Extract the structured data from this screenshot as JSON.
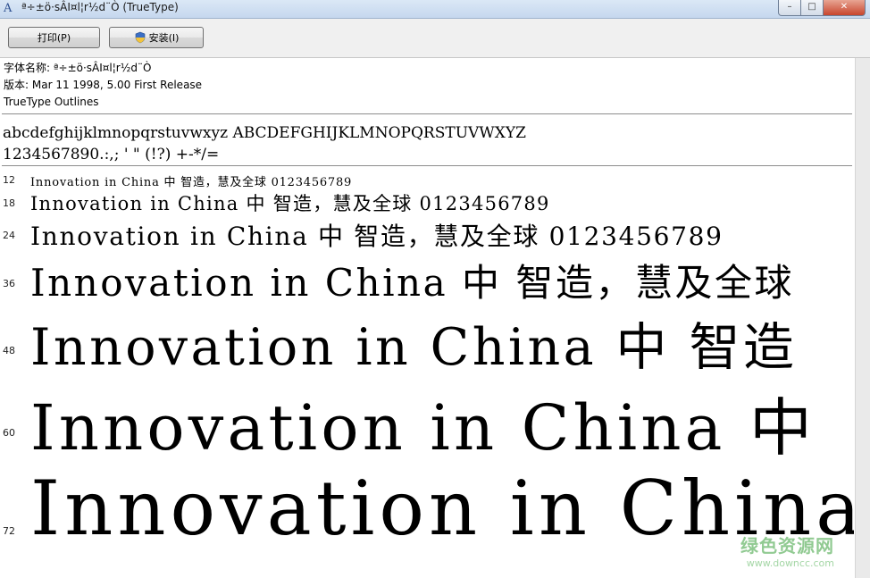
{
  "window": {
    "title": "ª÷±ö·sÂI¤l¦r½d¨Ò (TrueType)",
    "app_icon_glyph": "A",
    "minimize_glyph": "–",
    "maximize_glyph": "□",
    "close_glyph": "✕"
  },
  "toolbar": {
    "print_label": "打印(P)",
    "install_label": "安装(I)"
  },
  "font_info": {
    "name_line": "字体名称: ª÷±ö·sÂI¤l¦r½d¨Ò",
    "version_line": "版本: Mar 11 1998, 5.00 First Release",
    "type_line": "TrueType Outlines"
  },
  "charset": {
    "line1": "abcdefghijklmnopqrstuvwxyz ABCDEFGHIJKLMNOPQRSTUVWXYZ",
    "line2": "1234567890.:,; ' \" (!?) +-*/="
  },
  "samples": [
    {
      "size": "12",
      "text": "Innovation in China 中  智造，慧及全球 0123456789"
    },
    {
      "size": "18",
      "text": "Innovation in China 中  智造，慧及全球 0123456789"
    },
    {
      "size": "24",
      "text": "Innovation in China 中  智造，慧及全球 0123456789"
    },
    {
      "size": "36",
      "text": "Innovation in China 中  智造，慧及全球"
    },
    {
      "size": "48",
      "text": "Innovation in China 中  智造"
    },
    {
      "size": "60",
      "text": "Innovation in China 中"
    },
    {
      "size": "72",
      "text": "Innovation in China"
    }
  ],
  "watermark": {
    "cn": "绿色资源网",
    "url": "www.downcc.com"
  }
}
